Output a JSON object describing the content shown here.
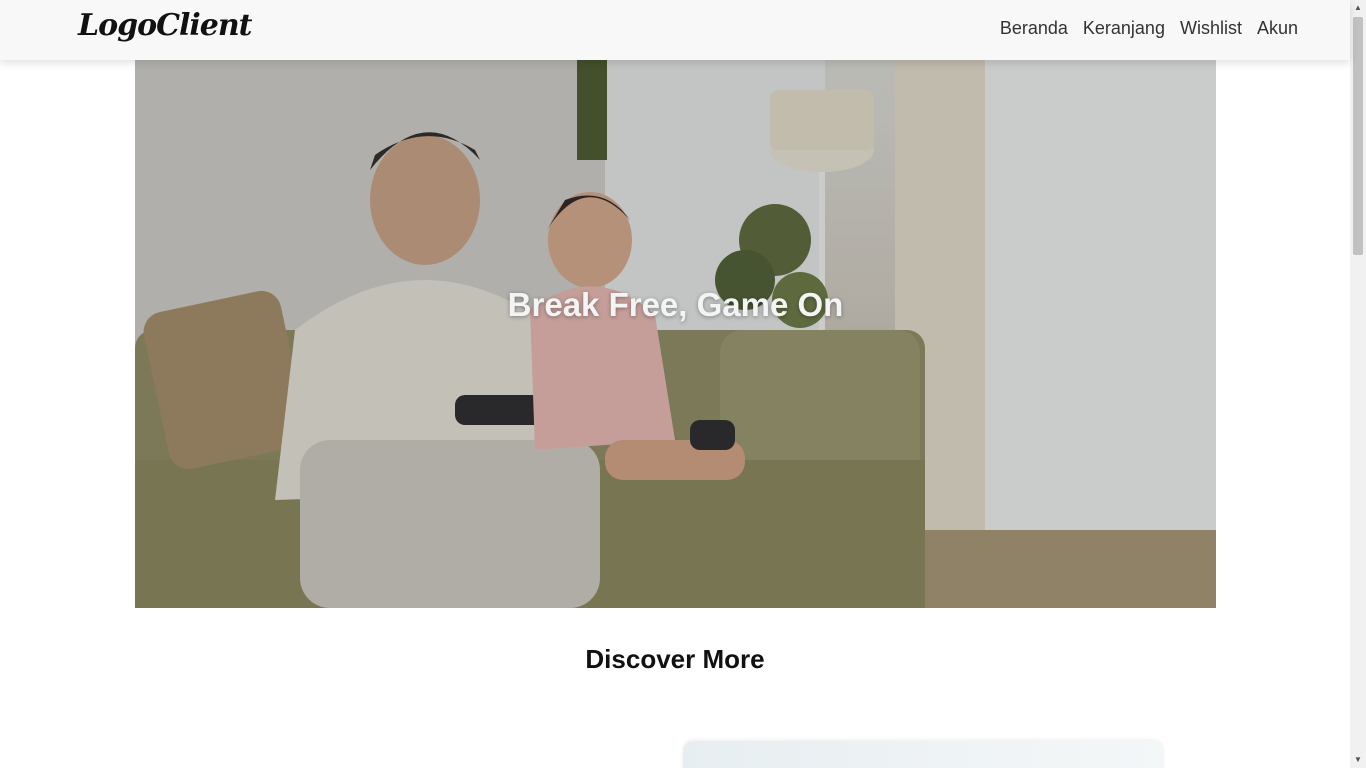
{
  "navbar": {
    "logo": "LogoClient",
    "links": [
      {
        "label": "Beranda"
      },
      {
        "label": "Keranjang"
      },
      {
        "label": "Wishlist"
      },
      {
        "label": "Akun"
      }
    ]
  },
  "hero": {
    "title": "Break Free, Game On"
  },
  "section": {
    "title": "Discover More"
  },
  "scrollbar": {
    "up_icon": "▲",
    "down_icon": "▼"
  }
}
